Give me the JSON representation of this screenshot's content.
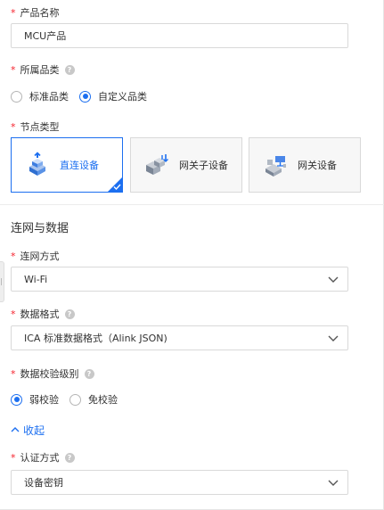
{
  "product_name": {
    "label": "产品名称",
    "required_mark": "*",
    "value": "MCU产品"
  },
  "category": {
    "label": "所属品类",
    "required_mark": "*",
    "help_glyph": "?",
    "options": [
      {
        "label": "标准品类",
        "selected": false
      },
      {
        "label": "自定义品类",
        "selected": true
      }
    ]
  },
  "node_type": {
    "label": "节点类型",
    "required_mark": "*",
    "cards": [
      {
        "label": "直连设备",
        "icon": "direct-device-icon",
        "selected": true
      },
      {
        "label": "网关子设备",
        "icon": "gateway-subdevice-icon",
        "selected": false
      },
      {
        "label": "网关设备",
        "icon": "gateway-device-icon",
        "selected": false
      }
    ]
  },
  "section": {
    "title": "连网与数据"
  },
  "network_method": {
    "label": "连网方式",
    "required_mark": "*",
    "value": "Wi-Fi"
  },
  "data_format": {
    "label": "数据格式",
    "required_mark": "*",
    "help_glyph": "?",
    "value": "ICA 标准数据格式（Alink JSON)"
  },
  "checksum_level": {
    "label": "数据校验级别",
    "required_mark": "*",
    "help_glyph": "?",
    "options": [
      {
        "label": "弱校验",
        "selected": true
      },
      {
        "label": "免校验",
        "selected": false
      }
    ]
  },
  "collapse_toggle": {
    "label": "收起",
    "icon": "chevron-up-icon"
  },
  "auth_method": {
    "label": "认证方式",
    "required_mark": "*",
    "help_glyph": "?",
    "value": "设备密钥"
  },
  "colors": {
    "accent": "#1c6ff0",
    "required": "#f5222d",
    "border": "#d9d9d9"
  }
}
